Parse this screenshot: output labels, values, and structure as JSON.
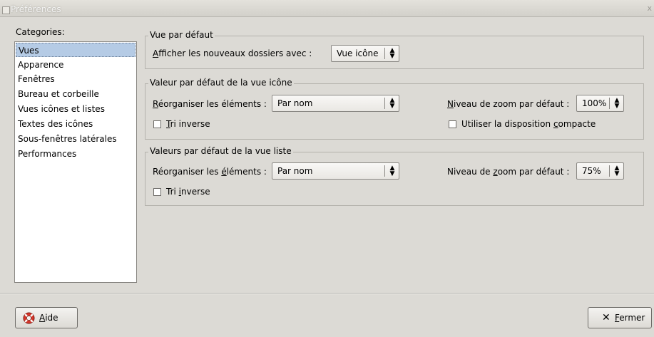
{
  "window": {
    "title": "Préférences",
    "close_glyph": "x"
  },
  "sidebar": {
    "label": "Categories:",
    "items": [
      {
        "label": "Vues"
      },
      {
        "label": "Apparence"
      },
      {
        "label": "Fenêtres"
      },
      {
        "label": "Bureau et corbeille"
      },
      {
        "label": "Vues icônes et listes"
      },
      {
        "label": "Textes des icônes"
      },
      {
        "label": "Sous-fenêtres latérales"
      },
      {
        "label": "Performances"
      }
    ],
    "selected_index": 0
  },
  "default_view": {
    "legend": "Vue par défaut",
    "label": "Afficher les nouveaux dossiers avec :",
    "value": "Vue icône"
  },
  "icon_view": {
    "legend": "Valeur par défaut de la vue icône",
    "arrange_label": "Réorganiser les éléments :",
    "arrange_value": "Par nom",
    "zoom_label": "Niveau de zoom par défaut :",
    "zoom_value": "100%",
    "reverse_label": "Tri inverse",
    "reverse_checked": false,
    "compact_label": "Utiliser la disposition compacte",
    "compact_checked": false
  },
  "list_view": {
    "legend": "Valeurs par défaut de la vue liste",
    "arrange_label": "Réorganiser les éléments :",
    "arrange_value": "Par nom",
    "zoom_label": "Niveau de zoom par défaut :",
    "zoom_value": "75%",
    "reverse_label": "Tri inverse",
    "reverse_checked": false
  },
  "footer": {
    "help_label": "Aide",
    "close_label": "Fermer",
    "help_icon": "lifebuoy-icon",
    "close_icon": "close-x-icon"
  }
}
